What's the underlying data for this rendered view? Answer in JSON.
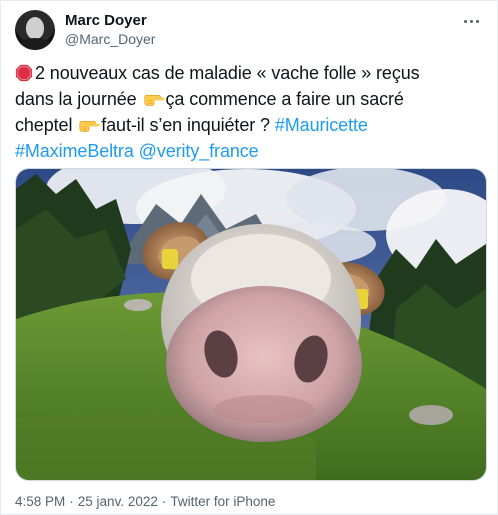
{
  "author": {
    "display_name": "Marc Doyer",
    "handle": "@Marc_Doyer"
  },
  "tweet": {
    "segments": [
      {
        "type": "icon",
        "icon": "stop-sign-icon"
      },
      {
        "type": "text",
        "text": "2 nouveaux cas de maladie « vache folle » reçus dans la journée "
      },
      {
        "type": "icon",
        "icon": "pointing-hand-icon"
      },
      {
        "type": "text",
        "text": "ça commence a faire un sacré cheptel "
      },
      {
        "type": "icon",
        "icon": "pointing-hand-icon"
      },
      {
        "type": "text",
        "text": "faut-il s’en inquiéter ? "
      },
      {
        "type": "hashtag",
        "text": "#Mauricette"
      },
      {
        "type": "text",
        "text": " "
      },
      {
        "type": "hashtag",
        "text": "#MaximeBeltra"
      },
      {
        "type": "text",
        "text": " "
      },
      {
        "type": "hashtag",
        "text": "@verity_france"
      }
    ],
    "text_part1": "2 nouveaux cas de maladie « vache folle » reçus",
    "text_part2": "dans la journée ",
    "text_part3": "ça commence a faire un sacré",
    "text_part4": "cheptel ",
    "text_part5": "faut-il s’en inquiéter ? ",
    "hashtag1": "#Mauricette",
    "hashtag2": "#MaximeBeltra",
    "mention1": "@verity_france"
  },
  "footer": {
    "time": "4:58 PM",
    "separator": "·",
    "date": "25 janv. 2022",
    "source": "Twitter for iPhone"
  },
  "colors": {
    "link": "#1d9bf0",
    "text": "#0f1419",
    "secondary": "#536471",
    "border": "#cfd9de"
  },
  "icons": {
    "more": "more-horizontal-icon",
    "stop": "stop-sign-icon",
    "hand": "pointing-hand-icon"
  }
}
